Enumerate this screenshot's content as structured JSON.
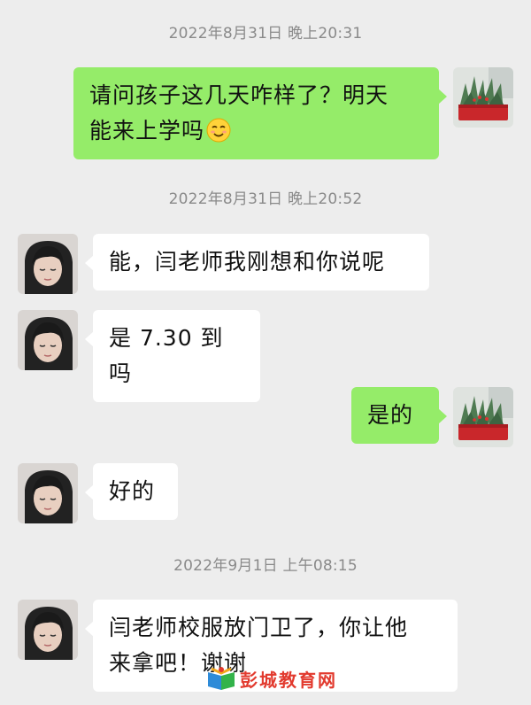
{
  "chat": {
    "timestamps": [
      "2022年8月31日 晚上20:31",
      "2022年8月31日 晚上20:52",
      "2022年9月1日 上午08:15"
    ],
    "messages": [
      {
        "sender": "me",
        "lines": [
          "请问孩子这几天咋样了？明天",
          "能来上学吗"
        ],
        "emoji": "smile-emoji"
      },
      {
        "sender": "parent",
        "lines": [
          "能，闫老师我刚想和你说呢"
        ]
      },
      {
        "sender": "parent",
        "lines": [
          "是 7.30 到吗"
        ]
      },
      {
        "sender": "me",
        "lines": [
          "是的"
        ]
      },
      {
        "sender": "parent",
        "lines": [
          "好的"
        ]
      },
      {
        "sender": "parent",
        "lines": [
          "闫老师校服放门卫了，你让他",
          "来拿吧！谢谢"
        ]
      }
    ]
  },
  "watermark": {
    "text": "彭城教育网",
    "color": "#e23a2e"
  },
  "colors": {
    "background": "#ededed",
    "outgoing_bubble": "#95ec69",
    "incoming_bubble": "#ffffff",
    "timestamp": "#8a8a8a"
  }
}
